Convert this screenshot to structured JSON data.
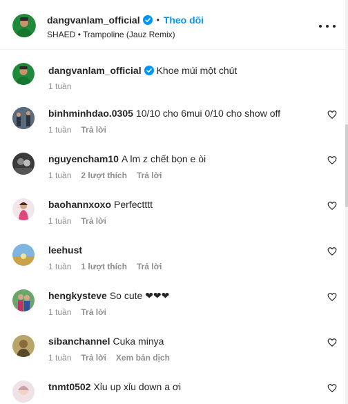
{
  "post": {
    "username": "dangvanlam_official",
    "follow_label": "Theo dõi",
    "dot": "•",
    "music_artist": "SHAED",
    "music_title": "Trampoline (Jauz Remix)",
    "caption_username": "dangvanlam_official",
    "caption_text": "Khoe múi một chút",
    "caption_time": "1 tuần"
  },
  "comments": [
    {
      "username": "binhminhdao.0305",
      "text": "10/10 cho 6mui 0/10 cho show off",
      "time": "1 tuần",
      "likes": "",
      "reply": "Trả lời",
      "extra": "",
      "avatar_color": "#3a4a5c"
    },
    {
      "username": "nguyencham10",
      "text": "A lm z chết bọn e òi",
      "time": "1 tuần",
      "likes": "2 lượt thích",
      "reply": "Trả lời",
      "extra": "",
      "avatar_color": "#2f2f2f"
    },
    {
      "username": "baohannxoxo",
      "text": "Perfectttt",
      "time": "1 tuần",
      "likes": "",
      "reply": "Trả lời",
      "extra": "",
      "avatar_color": "#e8a0b0"
    },
    {
      "username": "leehust",
      "text": "",
      "time": "1 tuần",
      "likes": "1 lượt thích",
      "reply": "Trả lời",
      "extra": "",
      "avatar_color": "#c9a24a"
    },
    {
      "username": "hengkysteve",
      "text": "So cute ❤❤❤",
      "time": "1 tuần",
      "likes": "",
      "reply": "Trả lời",
      "extra": "",
      "avatar_color": "#7a4a6a"
    },
    {
      "username": "sibanchannel",
      "text": "Cuka minya",
      "time": "1 tuần",
      "likes": "",
      "reply": "Trả lời",
      "extra": "Xem bản dịch",
      "avatar_color": "#9a8a50"
    },
    {
      "username": "tnmt0502",
      "text": "Xỉu up xỉu down a ơi",
      "time": "",
      "likes": "",
      "reply": "",
      "extra": "",
      "avatar_color": "#d8c0c8"
    }
  ],
  "icons": {
    "verified": "verified-badge-icon",
    "more": "more-options-icon",
    "heart": "heart-icon"
  },
  "colors": {
    "accent": "#0095f6",
    "muted": "#8e8e8e",
    "text": "#262626"
  }
}
